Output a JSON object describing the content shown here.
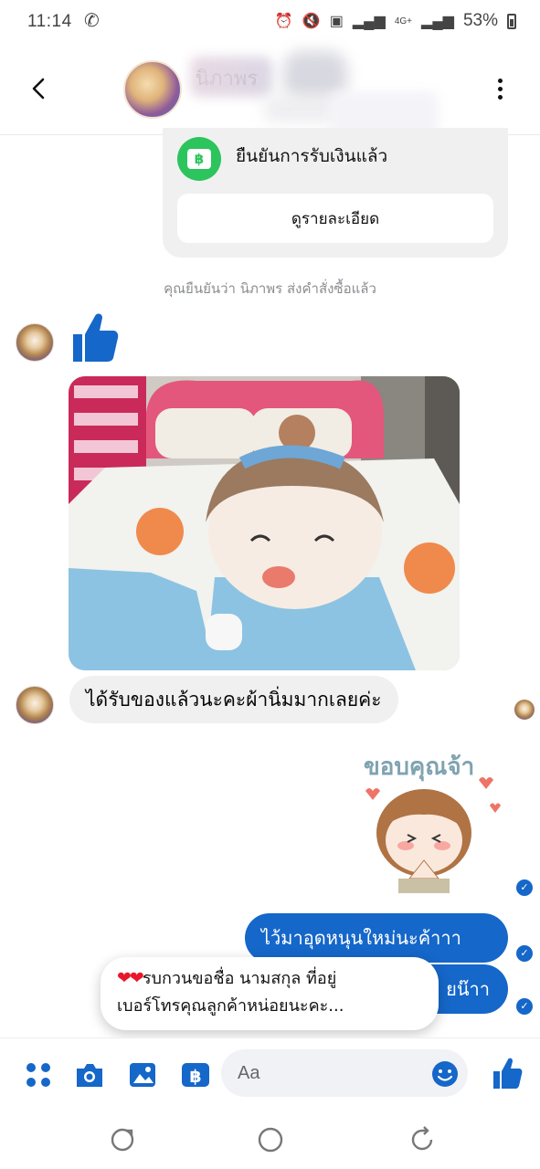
{
  "status_bar": {
    "time": "11:14",
    "network": "4G+",
    "battery": "53%"
  },
  "header": {
    "contact_name": "นิภาพร"
  },
  "payment_card": {
    "status_text": "ยืนยันการรับเงินแล้ว",
    "details_button": "ดูรายละเอียด",
    "accent_color": "#2cc45c"
  },
  "system_note": "คุณยืนยันว่า นิภาพร ส่งคำสั่งซื้อแล้ว",
  "messages": {
    "received_text": "ได้รับของแล้วนะคะผ้านิ่มมากเลยค่ะ",
    "sticker_caption": "ขอบคุณจ้า",
    "sent_1": "ไว้มาอุดหนุนใหม่นะค้าาา",
    "sent_2": "ยน๊าา"
  },
  "toast": {
    "hearts": "❤❤",
    "line_1": "รบกวนขอชื่อ นามสกุล ที่อยู่",
    "line_2": "เบอร์โทรคุณลูกค้าหน่อยนะคะ..."
  },
  "composer": {
    "placeholder": "Aa"
  },
  "colors": {
    "messenger_blue": "#1567c9",
    "bubble_gray": "#f0f0f0"
  }
}
